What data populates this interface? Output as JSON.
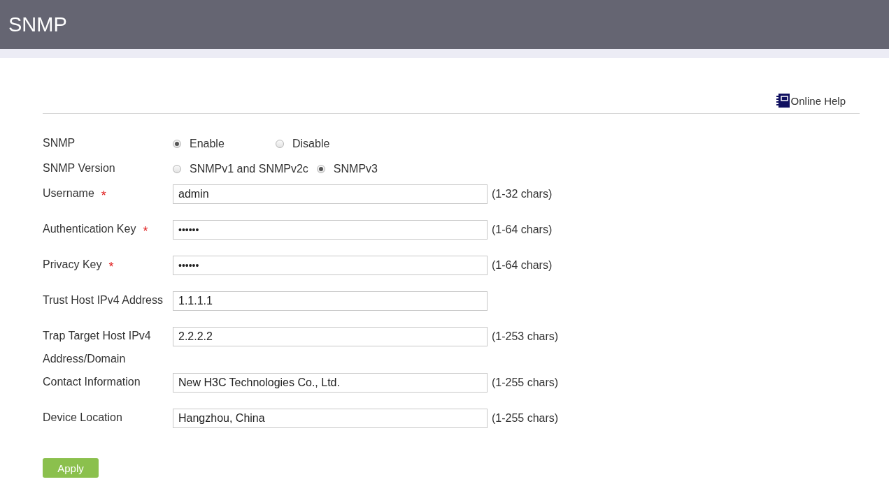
{
  "header": {
    "title": "SNMP"
  },
  "help": {
    "label": "Online Help"
  },
  "form": {
    "rows": [
      {
        "kind": "radio",
        "label": "SNMP",
        "options": [
          {
            "label": "Enable",
            "selected": true
          },
          {
            "label": "Disable",
            "selected": false
          }
        ]
      },
      {
        "kind": "radio",
        "label": "SNMP Version",
        "options": [
          {
            "label": "SNMPv1 and SNMPv2c",
            "selected": false
          },
          {
            "label": "SNMPv3",
            "selected": true
          }
        ]
      },
      {
        "kind": "text",
        "label": "Username",
        "required_mark": "*",
        "value": "admin",
        "hint": "(1-32 chars)"
      },
      {
        "kind": "password",
        "label": "Authentication Key",
        "required_mark": "*",
        "value": "••••••",
        "hint": "(1-64 chars)"
      },
      {
        "kind": "password",
        "label": "Privacy Key",
        "required_mark": "*",
        "value": "••••••",
        "hint": "(1-64 chars)"
      },
      {
        "kind": "text",
        "label": "Trust Host IPv4 Address",
        "value": "1.1.1.1"
      },
      {
        "kind": "text",
        "label": "Trap Target Host IPv4 Address/Domain",
        "value": "2.2.2.2",
        "hint": "(1-253 chars)"
      },
      {
        "kind": "text",
        "label": "Contact Information",
        "value": "New H3C Technologies Co., Ltd.",
        "hint": "(1-255 chars)"
      },
      {
        "kind": "text",
        "label": "Device Location",
        "value": "Hangzhou, China",
        "hint": "(1-255 chars)"
      }
    ]
  },
  "apply_button": {
    "label": "Apply"
  }
}
